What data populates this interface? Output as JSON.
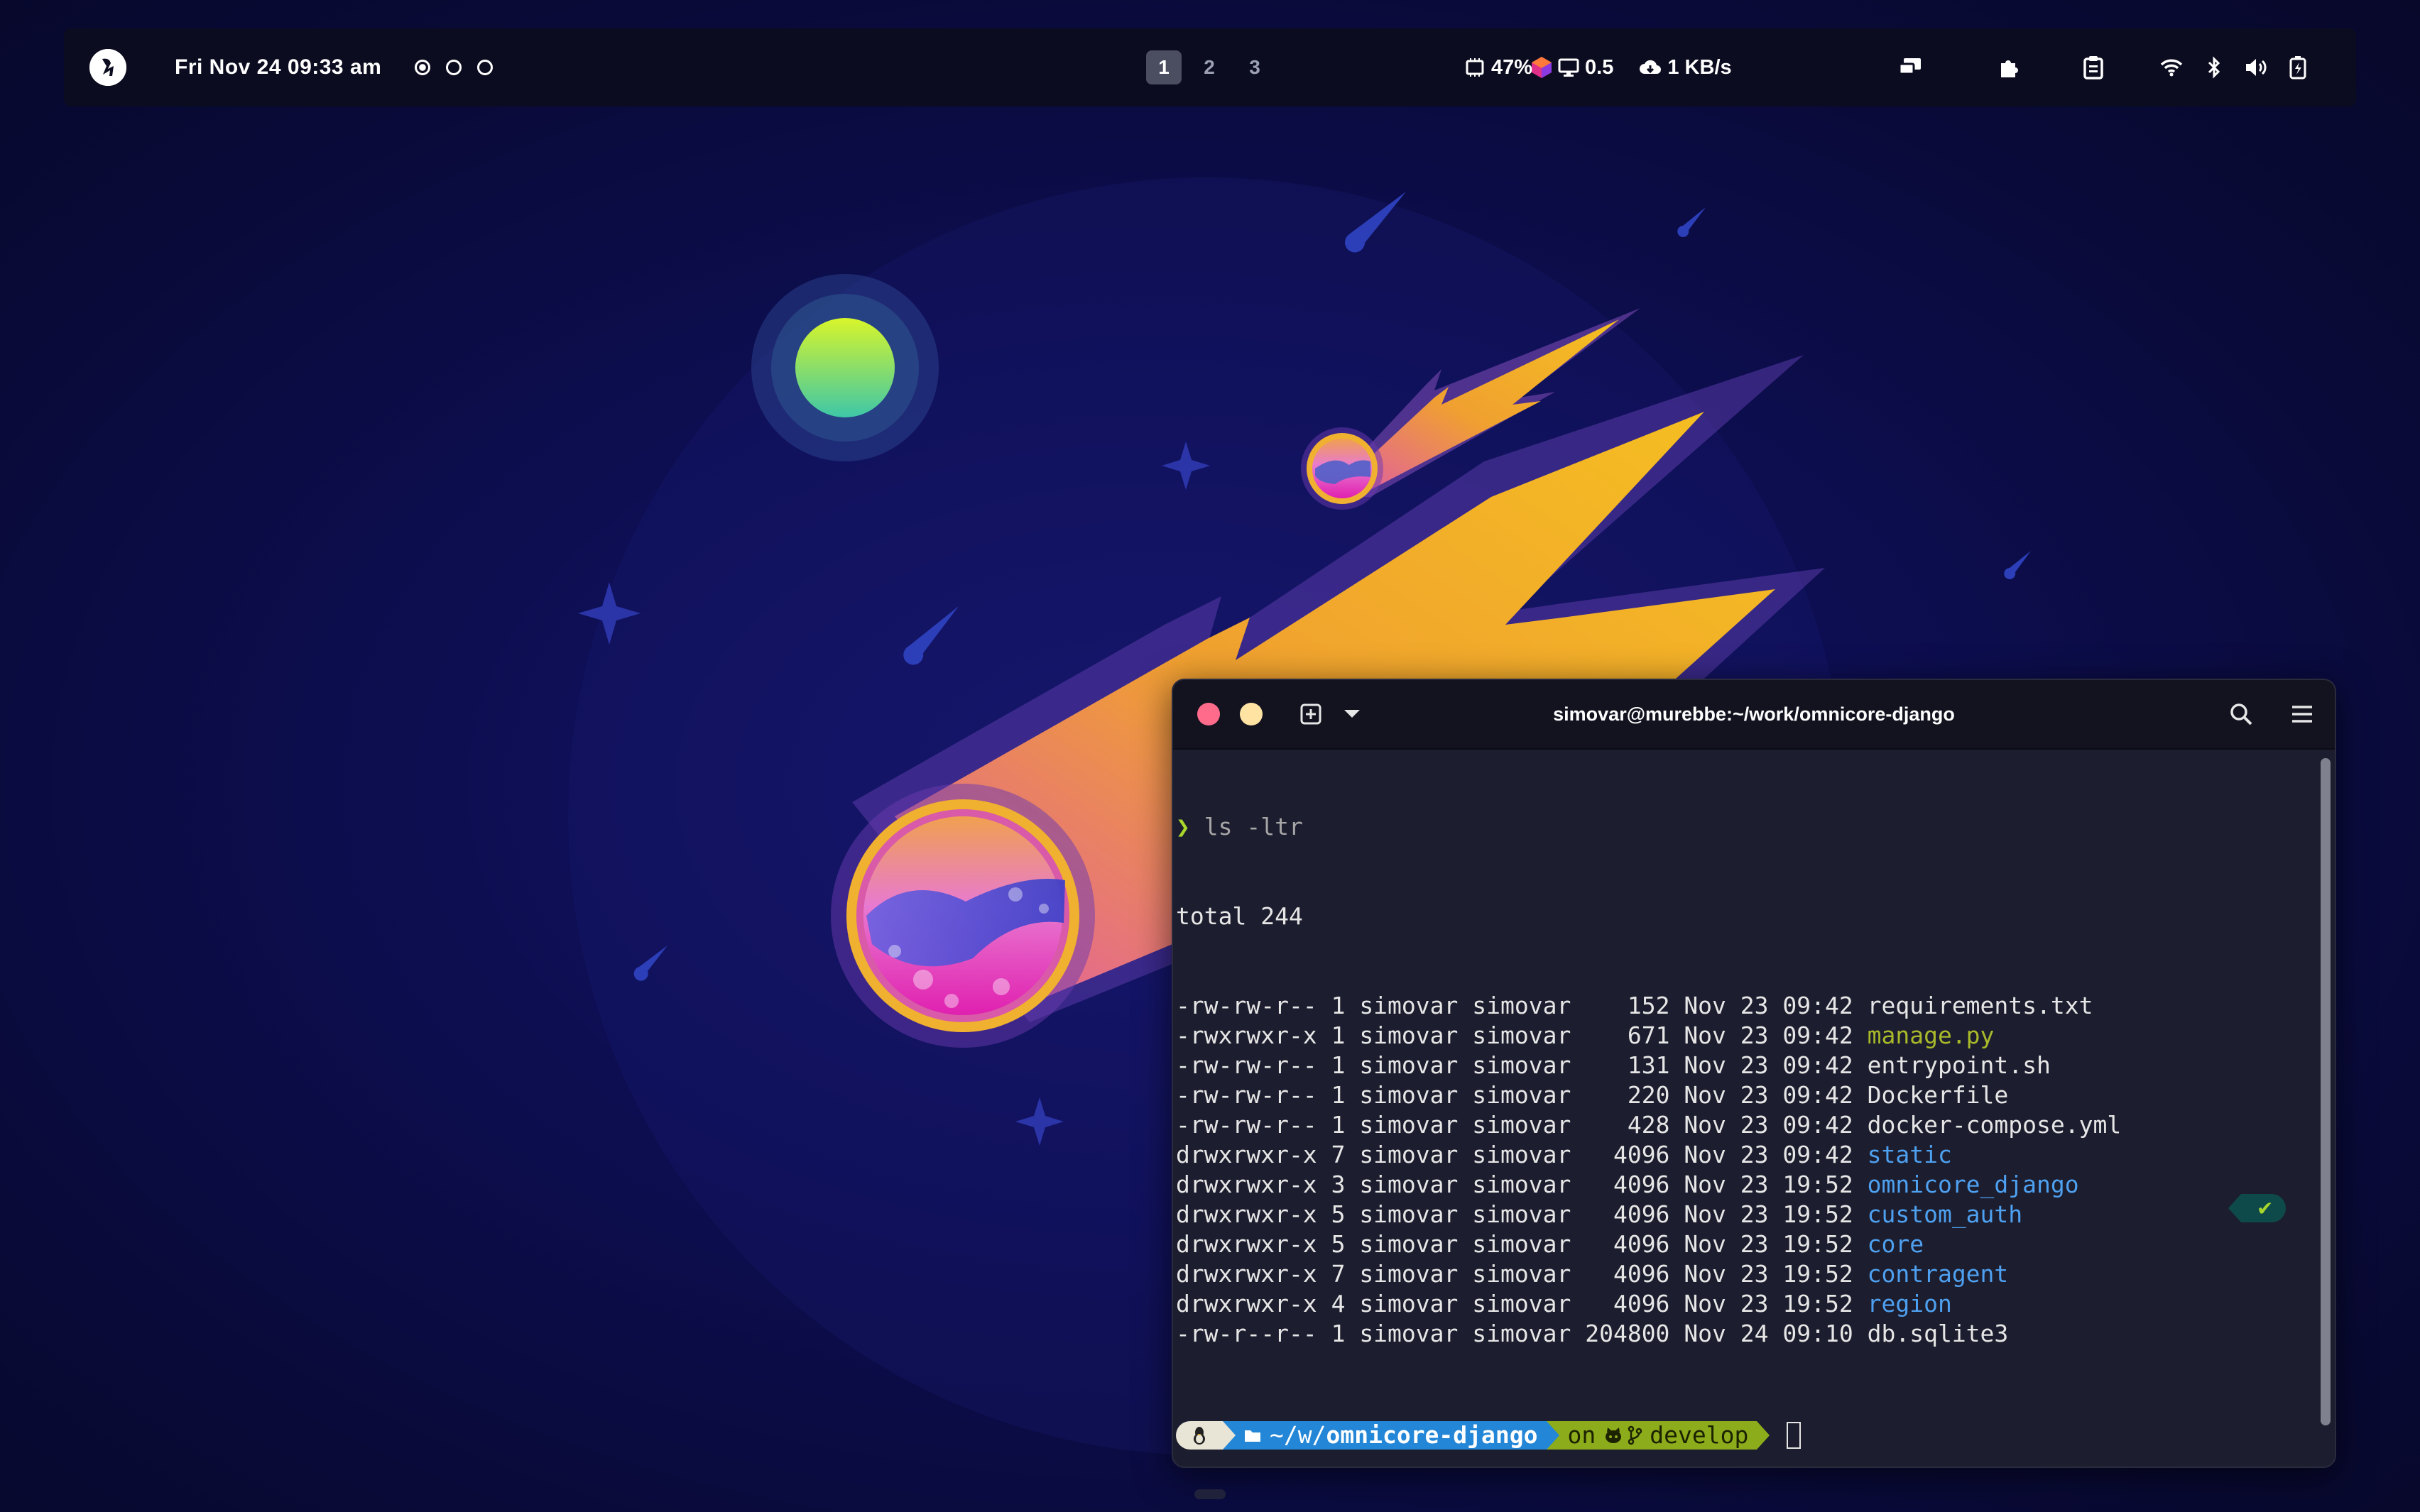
{
  "topbar": {
    "datetime": "Fri  Nov 24 09:33 am",
    "workspace_dots": [
      {
        "active": true
      },
      {
        "active": false
      },
      {
        "active": false
      }
    ],
    "workspaces": [
      {
        "label": "1",
        "active": true
      },
      {
        "label": "2",
        "active": false
      },
      {
        "label": "3",
        "active": false
      }
    ],
    "stats": {
      "cpu": "47%",
      "load": "0.5",
      "network": "1 KB/s"
    },
    "tray_icons": [
      "screen-share-icon",
      "extensions-icon",
      "clipboard-icon",
      "wifi-icon",
      "bluetooth-icon",
      "volume-icon",
      "battery-icon"
    ]
  },
  "terminal": {
    "title": "simovar@murebbe:~/work/omnicore-django",
    "command_prompt": "❯",
    "command": "ls -ltr",
    "total": "total 244",
    "listing": [
      {
        "perms": "-rw-rw-r--",
        "links": "1",
        "owner": "simovar",
        "group": "simovar",
        "size": "152",
        "date": "Nov 23 09:42",
        "name": "requirements.txt",
        "kind": "file"
      },
      {
        "perms": "-rwxrwxr-x",
        "links": "1",
        "owner": "simovar",
        "group": "simovar",
        "size": "671",
        "date": "Nov 23 09:42",
        "name": "manage.py",
        "kind": "exec"
      },
      {
        "perms": "-rw-rw-r--",
        "links": "1",
        "owner": "simovar",
        "group": "simovar",
        "size": "131",
        "date": "Nov 23 09:42",
        "name": "entrypoint.sh",
        "kind": "file"
      },
      {
        "perms": "-rw-rw-r--",
        "links": "1",
        "owner": "simovar",
        "group": "simovar",
        "size": "220",
        "date": "Nov 23 09:42",
        "name": "Dockerfile",
        "kind": "file"
      },
      {
        "perms": "-rw-rw-r--",
        "links": "1",
        "owner": "simovar",
        "group": "simovar",
        "size": "428",
        "date": "Nov 23 09:42",
        "name": "docker-compose.yml",
        "kind": "file"
      },
      {
        "perms": "drwxrwxr-x",
        "links": "7",
        "owner": "simovar",
        "group": "simovar",
        "size": "4096",
        "date": "Nov 23 09:42",
        "name": "static",
        "kind": "dir"
      },
      {
        "perms": "drwxrwxr-x",
        "links": "3",
        "owner": "simovar",
        "group": "simovar",
        "size": "4096",
        "date": "Nov 23 19:52",
        "name": "omnicore_django",
        "kind": "dir"
      },
      {
        "perms": "drwxrwxr-x",
        "links": "5",
        "owner": "simovar",
        "group": "simovar",
        "size": "4096",
        "date": "Nov 23 19:52",
        "name": "custom_auth",
        "kind": "dir"
      },
      {
        "perms": "drwxrwxr-x",
        "links": "5",
        "owner": "simovar",
        "group": "simovar",
        "size": "4096",
        "date": "Nov 23 19:52",
        "name": "core",
        "kind": "dir"
      },
      {
        "perms": "drwxrwxr-x",
        "links": "7",
        "owner": "simovar",
        "group": "simovar",
        "size": "4096",
        "date": "Nov 23 19:52",
        "name": "contragent",
        "kind": "dir"
      },
      {
        "perms": "drwxrwxr-x",
        "links": "4",
        "owner": "simovar",
        "group": "simovar",
        "size": "4096",
        "date": "Nov 23 19:52",
        "name": "region",
        "kind": "dir"
      },
      {
        "perms": "-rw-r--r--",
        "links": "1",
        "owner": "simovar",
        "group": "simovar",
        "size": "204800",
        "date": "Nov 24 09:10",
        "name": "db.sqlite3",
        "kind": "file"
      }
    ],
    "prompt": {
      "dir_prefix": "~/w/",
      "dir_name": "omnicore-django",
      "git_on": "on",
      "git_branch": "develop",
      "status": "✔"
    }
  },
  "colors": {
    "exec": "#a8b92a",
    "dir": "#4ea0f0",
    "close_dot": "#ff6b8b",
    "minimize_dot": "#ffe3a3"
  }
}
